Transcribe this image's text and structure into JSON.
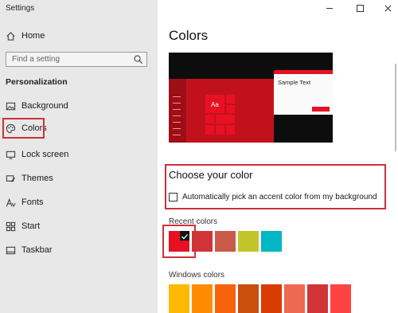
{
  "app": {
    "title": "Settings"
  },
  "sidebar": {
    "home": "Home",
    "search": {
      "placeholder": "Find a setting"
    },
    "section": "Personalization",
    "items": [
      "Background",
      "Colors",
      "Lock screen",
      "Themes",
      "Fonts",
      "Start",
      "Taskbar"
    ]
  },
  "main": {
    "title": "Colors",
    "preview": {
      "sample_text": "Sample Text",
      "tile_text": "Aa"
    },
    "choose_title": "Choose your color",
    "auto_pick": {
      "label": "Automatically pick an accent color from my background",
      "checked": false
    },
    "recent_label": "Recent colors",
    "recent_colors": [
      "#e81123",
      "#d13438",
      "#ca5b4a",
      "#c3c42b",
      "#00b7c3"
    ],
    "selected_recent_index": 0,
    "windows_label": "Windows colors",
    "windows_colors": [
      "#ffb900",
      "#ff8c00",
      "#f7630c",
      "#ca5010",
      "#da3b01",
      "#ef6950",
      "#d13438",
      "#ff4343"
    ]
  },
  "colors": {
    "accent": "#e81123",
    "highlight": "#d0303a"
  }
}
